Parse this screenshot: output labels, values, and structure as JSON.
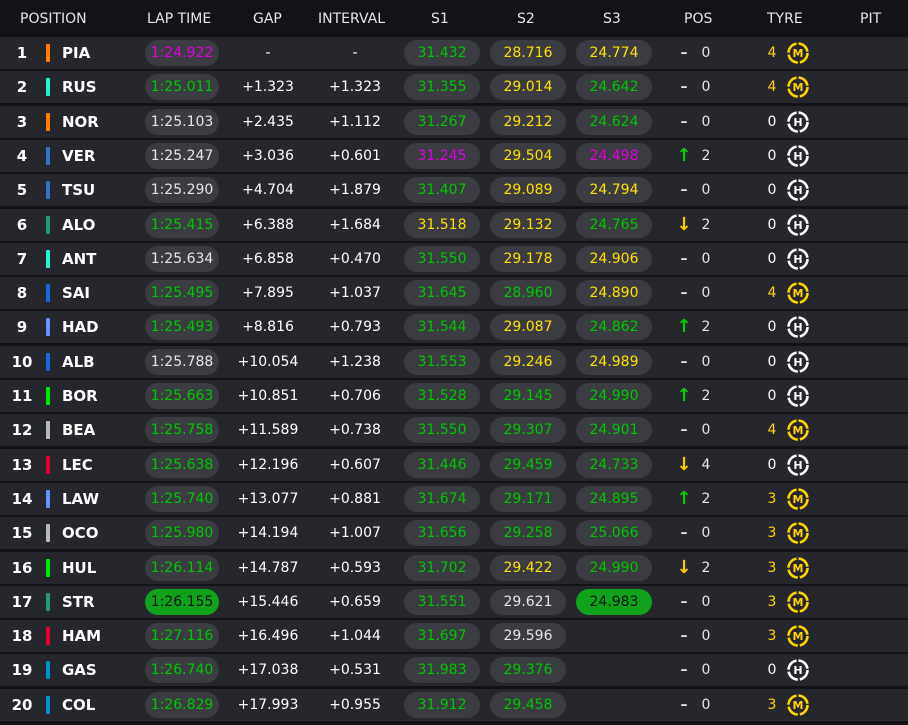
{
  "header": {
    "position": "POSITION",
    "lap_time": "LAP TIME",
    "gap": "GAP",
    "interval": "INTERVAL",
    "s1": "S1",
    "s2": "S2",
    "s3": "S3",
    "pos": "POS",
    "tyre": "TYRE",
    "pit": "PIT"
  },
  "colors": {
    "purple": "#e000e0",
    "green": "#00c800",
    "yellow": "#ffe000",
    "neutral": "#e6e6e6",
    "pill_dark": "#3b3c42",
    "pill_green_solid": "#0ea31b",
    "medium_tyre": "#ffd500",
    "hard_tyre": "#ffffff"
  },
  "rows": [
    {
      "pos": "1",
      "code": "PIA",
      "team_color": "#ff8000",
      "lap": "1:24.922",
      "lap_style": "purple",
      "gap": "-",
      "interval": "-",
      "s1": "31.432",
      "s1_style": "green",
      "s2": "28.716",
      "s2_style": "yellow",
      "s3": "24.774",
      "s3_style": "yellow",
      "pos_change": "-",
      "pos_delta": "0",
      "tyre_age": "4",
      "tyre": "M"
    },
    {
      "pos": "2",
      "code": "RUS",
      "team_color": "#27f4d2",
      "lap": "1:25.011",
      "lap_style": "green",
      "gap": "+1.323",
      "interval": "+1.323",
      "s1": "31.355",
      "s1_style": "green",
      "s2": "29.014",
      "s2_style": "yellow",
      "s3": "24.642",
      "s3_style": "green",
      "pos_change": "-",
      "pos_delta": "0",
      "tyre_age": "4",
      "tyre": "M"
    },
    {
      "pos": "3",
      "code": "NOR",
      "team_color": "#ff8000",
      "lap": "1:25.103",
      "lap_style": "neutral",
      "gap": "+2.435",
      "interval": "+1.112",
      "s1": "31.267",
      "s1_style": "green",
      "s2": "29.212",
      "s2_style": "yellow",
      "s3": "24.624",
      "s3_style": "green",
      "pos_change": "-",
      "pos_delta": "0",
      "tyre_age": "0",
      "tyre": "H"
    },
    {
      "pos": "4",
      "code": "VER",
      "team_color": "#3671c6",
      "lap": "1:25.247",
      "lap_style": "neutral",
      "gap": "+3.036",
      "interval": "+0.601",
      "s1": "31.245",
      "s1_style": "purple",
      "s2": "29.504",
      "s2_style": "yellow",
      "s3": "24.498",
      "s3_style": "purple",
      "pos_change": "up",
      "pos_delta": "2",
      "tyre_age": "0",
      "tyre": "H"
    },
    {
      "pos": "5",
      "code": "TSU",
      "team_color": "#3671c6",
      "lap": "1:25.290",
      "lap_style": "neutral",
      "gap": "+4.704",
      "interval": "+1.879",
      "s1": "31.407",
      "s1_style": "green",
      "s2": "29.089",
      "s2_style": "yellow",
      "s3": "24.794",
      "s3_style": "yellow",
      "pos_change": "-",
      "pos_delta": "0",
      "tyre_age": "0",
      "tyre": "H"
    },
    {
      "pos": "6",
      "code": "ALO",
      "team_color": "#229971",
      "lap": "1:25.415",
      "lap_style": "green",
      "gap": "+6.388",
      "interval": "+1.684",
      "s1": "31.518",
      "s1_style": "yellow",
      "s2": "29.132",
      "s2_style": "yellow",
      "s3": "24.765",
      "s3_style": "green",
      "pos_change": "down",
      "pos_delta": "2",
      "tyre_age": "0",
      "tyre": "H"
    },
    {
      "pos": "7",
      "code": "ANT",
      "team_color": "#27f4d2",
      "lap": "1:25.634",
      "lap_style": "neutral",
      "gap": "+6.858",
      "interval": "+0.470",
      "s1": "31.550",
      "s1_style": "green",
      "s2": "29.178",
      "s2_style": "yellow",
      "s3": "24.906",
      "s3_style": "yellow",
      "pos_change": "-",
      "pos_delta": "0",
      "tyre_age": "0",
      "tyre": "H"
    },
    {
      "pos": "8",
      "code": "SAI",
      "team_color": "#1868db",
      "lap": "1:25.495",
      "lap_style": "green",
      "gap": "+7.895",
      "interval": "+1.037",
      "s1": "31.645",
      "s1_style": "green",
      "s2": "28.960",
      "s2_style": "green",
      "s3": "24.890",
      "s3_style": "yellow",
      "pos_change": "-",
      "pos_delta": "0",
      "tyre_age": "4",
      "tyre": "M"
    },
    {
      "pos": "9",
      "code": "HAD",
      "team_color": "#6692ff",
      "lap": "1:25.493",
      "lap_style": "green",
      "gap": "+8.816",
      "interval": "+0.793",
      "s1": "31.544",
      "s1_style": "green",
      "s2": "29.087",
      "s2_style": "yellow",
      "s3": "24.862",
      "s3_style": "green",
      "pos_change": "up",
      "pos_delta": "2",
      "tyre_age": "0",
      "tyre": "H"
    },
    {
      "pos": "10",
      "code": "ALB",
      "team_color": "#1868db",
      "lap": "1:25.788",
      "lap_style": "neutral",
      "gap": "+10.054",
      "interval": "+1.238",
      "s1": "31.553",
      "s1_style": "green",
      "s2": "29.246",
      "s2_style": "yellow",
      "s3": "24.989",
      "s3_style": "yellow",
      "pos_change": "-",
      "pos_delta": "0",
      "tyre_age": "0",
      "tyre": "H"
    },
    {
      "pos": "11",
      "code": "BOR",
      "team_color": "#00e701",
      "lap": "1:25.663",
      "lap_style": "green",
      "gap": "+10.851",
      "interval": "+0.706",
      "s1": "31.528",
      "s1_style": "green",
      "s2": "29.145",
      "s2_style": "green",
      "s3": "24.990",
      "s3_style": "green",
      "pos_change": "up",
      "pos_delta": "2",
      "tyre_age": "0",
      "tyre": "H"
    },
    {
      "pos": "12",
      "code": "BEA",
      "team_color": "#b6babd",
      "lap": "1:25.758",
      "lap_style": "green",
      "gap": "+11.589",
      "interval": "+0.738",
      "s1": "31.550",
      "s1_style": "green",
      "s2": "29.307",
      "s2_style": "green",
      "s3": "24.901",
      "s3_style": "green",
      "pos_change": "-",
      "pos_delta": "0",
      "tyre_age": "4",
      "tyre": "M"
    },
    {
      "pos": "13",
      "code": "LEC",
      "team_color": "#e8002d",
      "lap": "1:25.638",
      "lap_style": "green",
      "gap": "+12.196",
      "interval": "+0.607",
      "s1": "31.446",
      "s1_style": "green",
      "s2": "29.459",
      "s2_style": "green",
      "s3": "24.733",
      "s3_style": "green",
      "pos_change": "down",
      "pos_delta": "4",
      "tyre_age": "0",
      "tyre": "H"
    },
    {
      "pos": "14",
      "code": "LAW",
      "team_color": "#6692ff",
      "lap": "1:25.740",
      "lap_style": "green",
      "gap": "+13.077",
      "interval": "+0.881",
      "s1": "31.674",
      "s1_style": "green",
      "s2": "29.171",
      "s2_style": "green",
      "s3": "24.895",
      "s3_style": "green",
      "pos_change": "up",
      "pos_delta": "2",
      "tyre_age": "3",
      "tyre": "M"
    },
    {
      "pos": "15",
      "code": "OCO",
      "team_color": "#b6babd",
      "lap": "1:25.980",
      "lap_style": "green",
      "gap": "+14.194",
      "interval": "+1.007",
      "s1": "31.656",
      "s1_style": "green",
      "s2": "29.258",
      "s2_style": "green",
      "s3": "25.066",
      "s3_style": "green",
      "pos_change": "-",
      "pos_delta": "0",
      "tyre_age": "3",
      "tyre": "M"
    },
    {
      "pos": "16",
      "code": "HUL",
      "team_color": "#00e701",
      "lap": "1:26.114",
      "lap_style": "green",
      "gap": "+14.787",
      "interval": "+0.593",
      "s1": "31.702",
      "s1_style": "green",
      "s2": "29.422",
      "s2_style": "yellow",
      "s3": "24.990",
      "s3_style": "green",
      "pos_change": "down",
      "pos_delta": "2",
      "tyre_age": "3",
      "tyre": "M"
    },
    {
      "pos": "17",
      "code": "STR",
      "team_color": "#229971",
      "lap": "1:26.155",
      "lap_style": "green_solid",
      "gap": "+15.446",
      "interval": "+0.659",
      "s1": "31.551",
      "s1_style": "green",
      "s2": "29.621",
      "s2_style": "neutral",
      "s3": "24.983",
      "s3_style": "green_solid",
      "pos_change": "-",
      "pos_delta": "0",
      "tyre_age": "3",
      "tyre": "M"
    },
    {
      "pos": "18",
      "code": "HAM",
      "team_color": "#e8002d",
      "lap": "1:27.116",
      "lap_style": "green",
      "gap": "+16.496",
      "interval": "+1.044",
      "s1": "31.697",
      "s1_style": "green",
      "s2": "29.596",
      "s2_style": "neutral",
      "s3": "",
      "s3_style": "none",
      "pos_change": "-",
      "pos_delta": "0",
      "tyre_age": "3",
      "tyre": "M"
    },
    {
      "pos": "19",
      "code": "GAS",
      "team_color": "#0093cc",
      "lap": "1:26.740",
      "lap_style": "green",
      "gap": "+17.038",
      "interval": "+0.531",
      "s1": "31.983",
      "s1_style": "green",
      "s2": "29.376",
      "s2_style": "green",
      "s3": "",
      "s3_style": "none",
      "pos_change": "-",
      "pos_delta": "0",
      "tyre_age": "0",
      "tyre": "H"
    },
    {
      "pos": "20",
      "code": "COL",
      "team_color": "#0093cc",
      "lap": "1:26.829",
      "lap_style": "green",
      "gap": "+17.993",
      "interval": "+0.955",
      "s1": "31.912",
      "s1_style": "green",
      "s2": "29.458",
      "s2_style": "green",
      "s3": "",
      "s3_style": "none",
      "pos_change": "-",
      "pos_delta": "0",
      "tyre_age": "3",
      "tyre": "M"
    }
  ]
}
